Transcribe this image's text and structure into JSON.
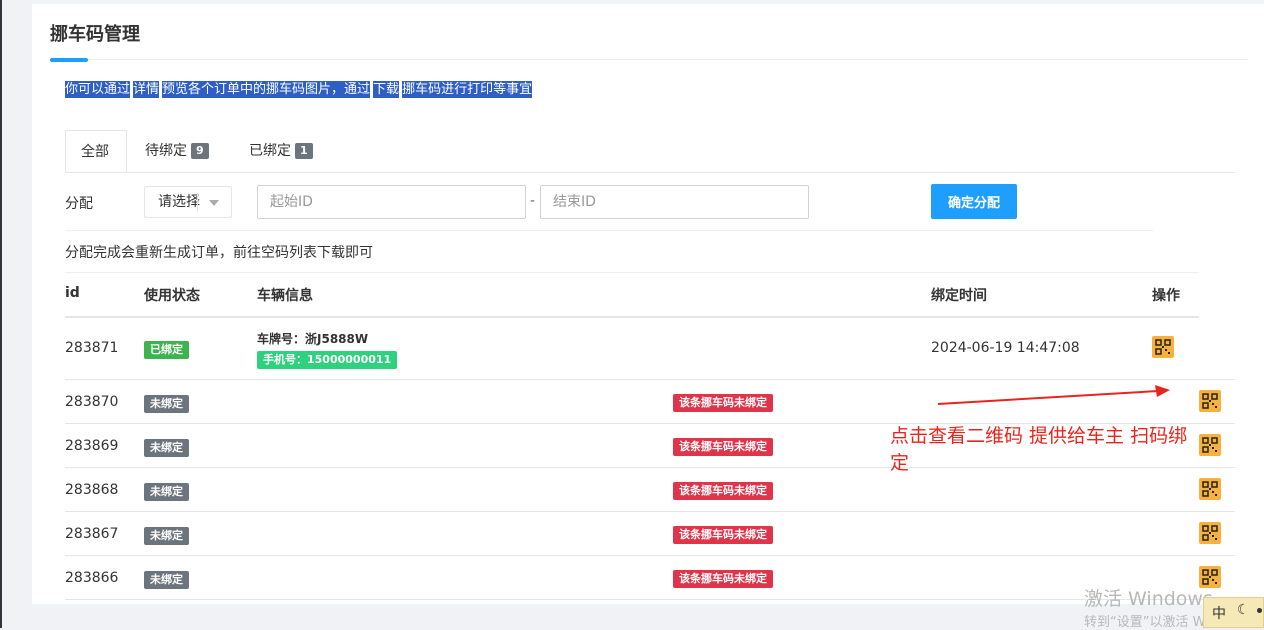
{
  "page": {
    "title": "挪车码管理"
  },
  "tip": {
    "p1": "你可以通过",
    "link1": "详情",
    "p2": "预览各个订单中的挪车码图片，通过",
    "link2": "下载",
    "p3": "挪车码进行打印等事宜"
  },
  "tabs": [
    {
      "label": "全部",
      "count": ""
    },
    {
      "label": "待绑定",
      "count": "9"
    },
    {
      "label": "已绑定",
      "count": "1"
    }
  ],
  "assign": {
    "label": "分配",
    "select_value": "请选择",
    "start_placeholder": "起始ID",
    "dash": "-",
    "end_placeholder": "结束ID",
    "button": "确定分配",
    "note": "分配完成会重新生成订单，前往空码列表下载即可"
  },
  "table": {
    "headers": {
      "id": "id",
      "status": "使用状态",
      "vehicle": "车辆信息",
      "time": "绑定时间",
      "action": "操作"
    },
    "rows": [
      {
        "id": "283871",
        "status": "已绑定",
        "plate": "车牌号：浙J5888W",
        "phone": "手机号：15000000011",
        "time": "2024-06-19 14:47:08"
      },
      {
        "id": "283870",
        "status": "未绑定",
        "unbound_note": "该条挪车码未绑定"
      },
      {
        "id": "283869",
        "status": "未绑定",
        "unbound_note": "该条挪车码未绑定"
      },
      {
        "id": "283868",
        "status": "未绑定",
        "unbound_note": "该条挪车码未绑定"
      },
      {
        "id": "283867",
        "status": "未绑定",
        "unbound_note": "该条挪车码未绑定"
      },
      {
        "id": "283866",
        "status": "未绑定",
        "unbound_note": "该条挪车码未绑定"
      }
    ]
  },
  "annotation": {
    "text": "点击查看二维码 提供给车主 扫码绑定",
    "color": "#e8251c"
  },
  "watermark": {
    "line1": "激活 Windows",
    "line2": "转到“设置”以激活 Windows"
  },
  "ime": {
    "label": "中"
  },
  "colors": {
    "accent": "#1e9fff",
    "bound": "#3fb34f",
    "unbound": "#6c757d",
    "warn": "#e0344a",
    "phone": "#2ed17d",
    "qr": "#f7b13c"
  },
  "icons": {
    "qr": "qrcode-icon"
  }
}
